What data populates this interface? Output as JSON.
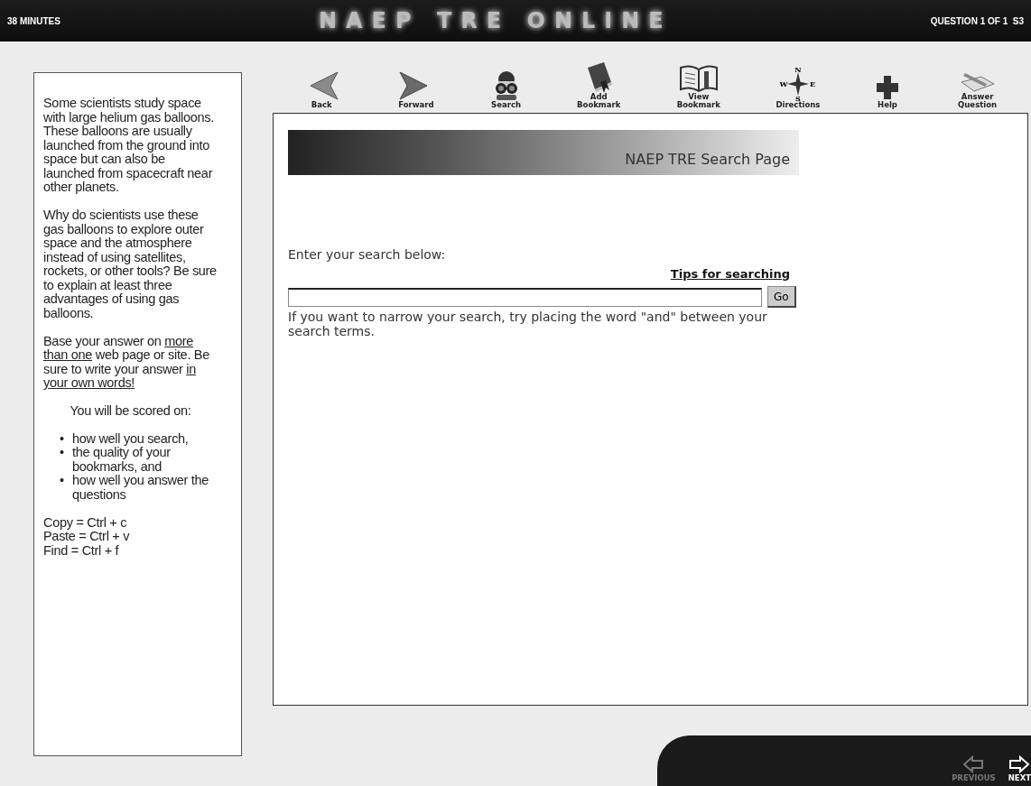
{
  "header": {
    "timer": "38 MINUTES",
    "title": "NAEP TRE ONLINE",
    "question": "QUESTION 1 OF 1  S3"
  },
  "toolbar": [
    {
      "kind": "back",
      "label": "Back"
    },
    {
      "kind": "forward",
      "label": "Forward"
    },
    {
      "kind": "search",
      "label": "Search"
    },
    {
      "kind": "add_bookmark",
      "label": "Add Bookmark"
    },
    {
      "kind": "view_bookmark",
      "label": "View Bookmark"
    },
    {
      "kind": "directions",
      "label": "Directions",
      "letters": [
        "N",
        "W",
        "E",
        "S"
      ]
    },
    {
      "kind": "help",
      "label": "Help"
    },
    {
      "kind": "answer",
      "label": "Answer Question"
    }
  ],
  "prompt": {
    "paragraphs": [
      [
        {
          "text": "Some scientists study space with large helium gas balloons. These balloons are usually launched from the ground into space but can also be launched from spacecraft near other planets.",
          "underline": false
        }
      ],
      [
        {
          "text": "Why do scientists use these gas balloons to explore outer space and the atmosphere instead of using satellites, rockets, or other tools? Be sure to explain at least three advantages of using gas balloons.",
          "underline": false
        }
      ],
      [
        {
          "text": "Base your answer on ",
          "underline": false
        },
        {
          "text": "more than one",
          "underline": true
        },
        {
          "text": " web page or site. Be sure to write your answer ",
          "underline": false
        },
        {
          "text": "in your own words!",
          "underline": true
        }
      ]
    ],
    "scored_heading": "You will be scored on:",
    "scored_items": [
      {
        "marker": "•",
        "text": "how well you search,"
      },
      {
        "marker": "•",
        "text": "the quality of your bookmarks, and"
      },
      {
        "marker": "•",
        "text": "how well you answer the questions"
      }
    ],
    "shortcuts": [
      "Copy = Ctrl + c",
      "Paste = Ctrl + v",
      "Find = Ctrl + f"
    ]
  },
  "search_page": {
    "banner_title": "NAEP TRE Search Page",
    "instruction": "Enter your search below:",
    "tips_link": "Tips for searching",
    "go_button": "Go",
    "hint": "If you want to narrow your search, try placing the word \"and\" between your search terms."
  },
  "nav": [
    {
      "kind": "previous",
      "label": "PREVIOUS",
      "disabled": true
    },
    {
      "kind": "next",
      "label": "NEXT",
      "disabled": false
    }
  ]
}
